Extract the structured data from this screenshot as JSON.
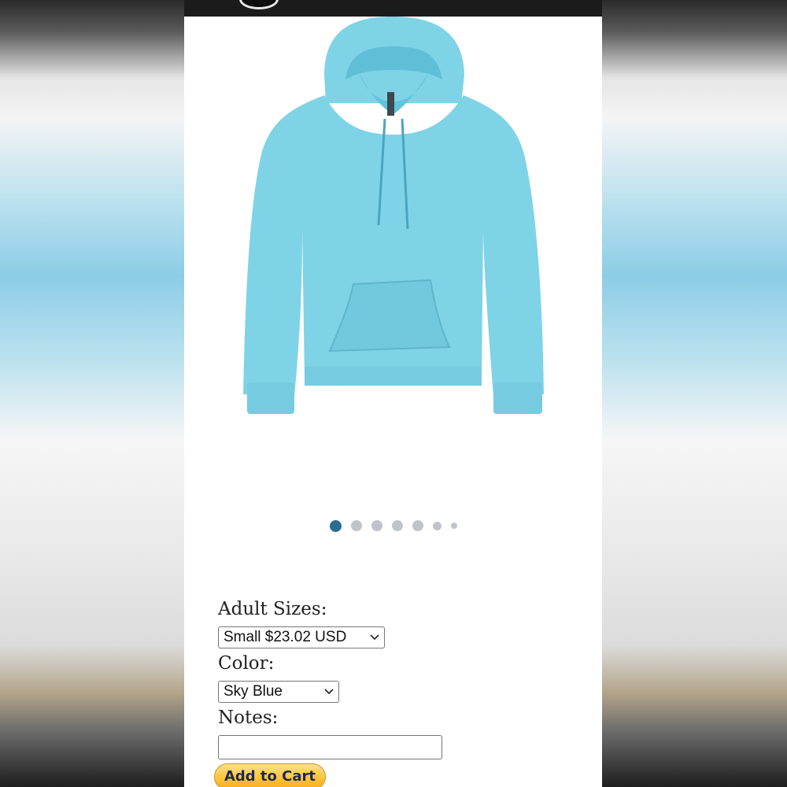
{
  "product": {
    "image_alt": "Sky blue pullover hoodie",
    "color_hex": "#7fd3e6"
  },
  "carousel": {
    "total_dots": 7,
    "active_index": 0
  },
  "form": {
    "sizes_label": "Adult Sizes:",
    "sizes_selected": "Small $23.02 USD",
    "color_label": "Color:",
    "color_selected": "Sky Blue",
    "notes_label": "Notes:",
    "notes_value": "",
    "add_to_cart_label": "Add to Cart"
  },
  "icons": {
    "dropdown": "chevron-down-icon",
    "logo": "logo-icon"
  },
  "colors": {
    "active_dot": "#2b6d8f",
    "inactive_dot": "#bfc4cb",
    "button": "#ffc439"
  }
}
